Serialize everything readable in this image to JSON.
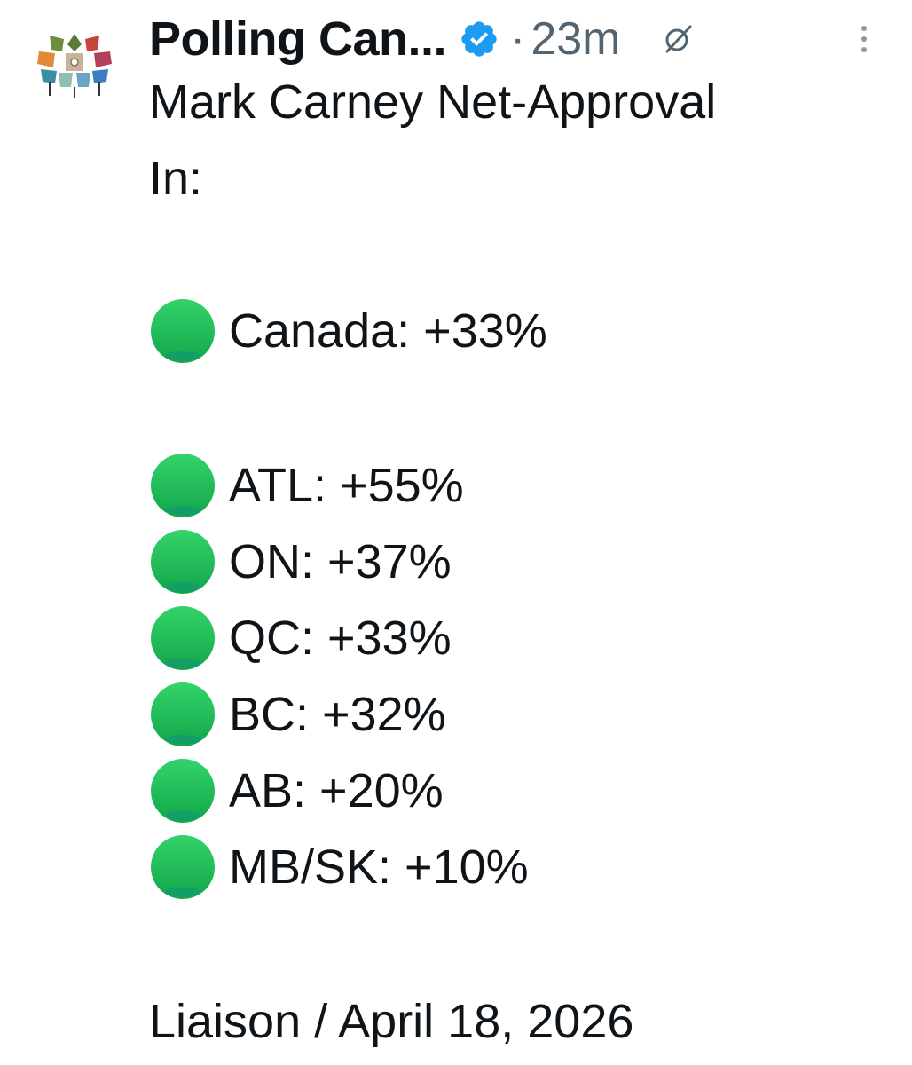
{
  "author": {
    "name": "Polling Can...",
    "verified_icon": "verified-badge-icon",
    "avatar_icon": "maple-leaf-logo"
  },
  "meta": {
    "separator": "·",
    "time": "23m"
  },
  "post": {
    "title_line1": "Mark Carney Net-Approval",
    "title_line2": "In:",
    "national": {
      "label": "Canada: +33%"
    },
    "regions": [
      {
        "label": "ATL: +55%"
      },
      {
        "label": "ON: +37%"
      },
      {
        "label": "QC: +33%"
      },
      {
        "label": "BC: +32%"
      },
      {
        "label": "AB: +20%"
      },
      {
        "label": "MB/SK: +10%"
      }
    ],
    "source": "Liaison / April 18, 2026"
  },
  "colors": {
    "verified": "#1d9bf0",
    "green_circle": "#21c15a",
    "meta_text": "#536471"
  }
}
